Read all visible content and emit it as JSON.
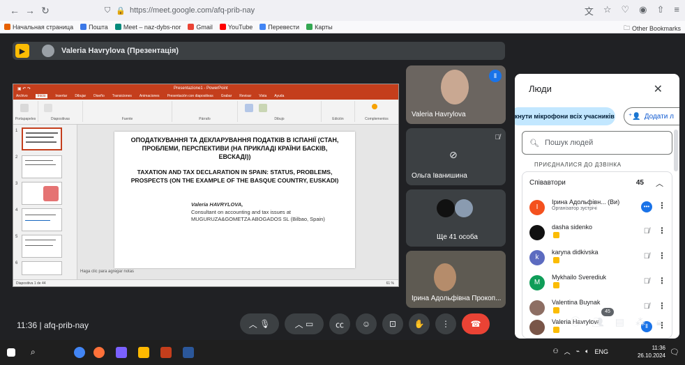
{
  "browser": {
    "url": "https://meet.google.com/afq-prib-nay",
    "bookmarks": [
      {
        "label": "Начальная страница",
        "color": "#e66000"
      },
      {
        "label": "Пошта",
        "color": "#3b78e7"
      },
      {
        "label": "Meet – naz-dybs-nor",
        "color": "#00897b"
      },
      {
        "label": "Gmail",
        "color": "#ea4335"
      },
      {
        "label": "YouTube",
        "color": "#ff0000"
      },
      {
        "label": "Перевести",
        "color": "#4285f4"
      },
      {
        "label": "Карты",
        "color": "#34a853"
      }
    ],
    "other_bookmarks": "Other Bookmarks"
  },
  "meet": {
    "presenter_label": "Valeria Havrylova (Презентація)",
    "time": "11:36",
    "meeting_code": "afq-prib-nay",
    "participant_count": "45"
  },
  "ppt": {
    "title": "Presentazione1 - PowerPoint",
    "tabs": [
      "Archivo",
      "Inicio",
      "Insertar",
      "Dibujar",
      "Diseño",
      "Transiciones",
      "Animaciones",
      "Presentación con diapositivas",
      "Grabar",
      "Revisar",
      "Vista",
      "Ayuda"
    ],
    "groups": [
      "Portapapeles",
      "Diapositivas",
      "Fuente",
      "Párrafo",
      "Dibujo",
      "Edición",
      "Complementos"
    ],
    "notes_hint": "Haga clic para agregar notas",
    "status": "Diapositiva 1 de 44",
    "zoom": "61 %",
    "thumb_numbers": [
      "1",
      "2",
      "3",
      "4",
      "5",
      "6"
    ]
  },
  "slide": {
    "title_ua": "ОПОДАТКУВАННЯ ТА ДЕКЛАРУВАННЯ ПОДАТКІВ В ІСПАНІЇ (СТАН, ПРОБЛЕМИ, ПЕРСПЕКТИВИ (НА ПРИКЛАДІ КРАЇНИ БАСКІВ, ЕВСКАДІ))",
    "title_en": "TAXATION AND TAX DECLARATION IN SPAIN: STATUS, PROBLEMS, PROSPECTS (ON THE EXAMPLE OF THE BASQUE COUNTRY, EUSKADI)",
    "author": "Valeria HAVRYLOVA,",
    "role_1": "Consultant on accounting and tax issues at",
    "role_2": "MUGURUZA&GOMETZA ABOGADOS SL (Bilbao, Spain)"
  },
  "tiles": {
    "t1": "Valeria Havrylova",
    "t2": "Ольга Іванишина",
    "t3": "Ще 41 особа",
    "t4": "Ірина Адольфівна Прокоп..."
  },
  "panel": {
    "title": "Люди",
    "mute_all": "мкнути мікрофони всіх учасників",
    "add_people": "Додати л",
    "search_placeholder": "Пошук людей",
    "joined_label": "ПРИЄДНАЛИСЯ ДО ДЗВІНКА",
    "group_label": "Співавтори",
    "group_count": "45",
    "people": [
      {
        "name": "Ірина Адольфівн... (Ви)",
        "role": "Організатор зустрічі",
        "initial": "І",
        "color": "#f4511e"
      },
      {
        "name": "dasha sidenko",
        "role": "",
        "initial": "",
        "color": "#111111"
      },
      {
        "name": "karyna didkivska",
        "role": "",
        "initial": "k",
        "color": "#5c6bc0"
      },
      {
        "name": "Mykhailo Sverediuk",
        "role": "",
        "initial": "M",
        "color": "#0f9d58"
      },
      {
        "name": "Valentina Buynak",
        "role": "",
        "initial": "",
        "color": "#8d6e63"
      },
      {
        "name": "Valeria Havrylova",
        "role": "",
        "initial": "",
        "color": "#795548"
      }
    ]
  },
  "taskbar": {
    "clock_time": "11:36",
    "clock_date": "26.10.2024",
    "lang": "ENG"
  }
}
